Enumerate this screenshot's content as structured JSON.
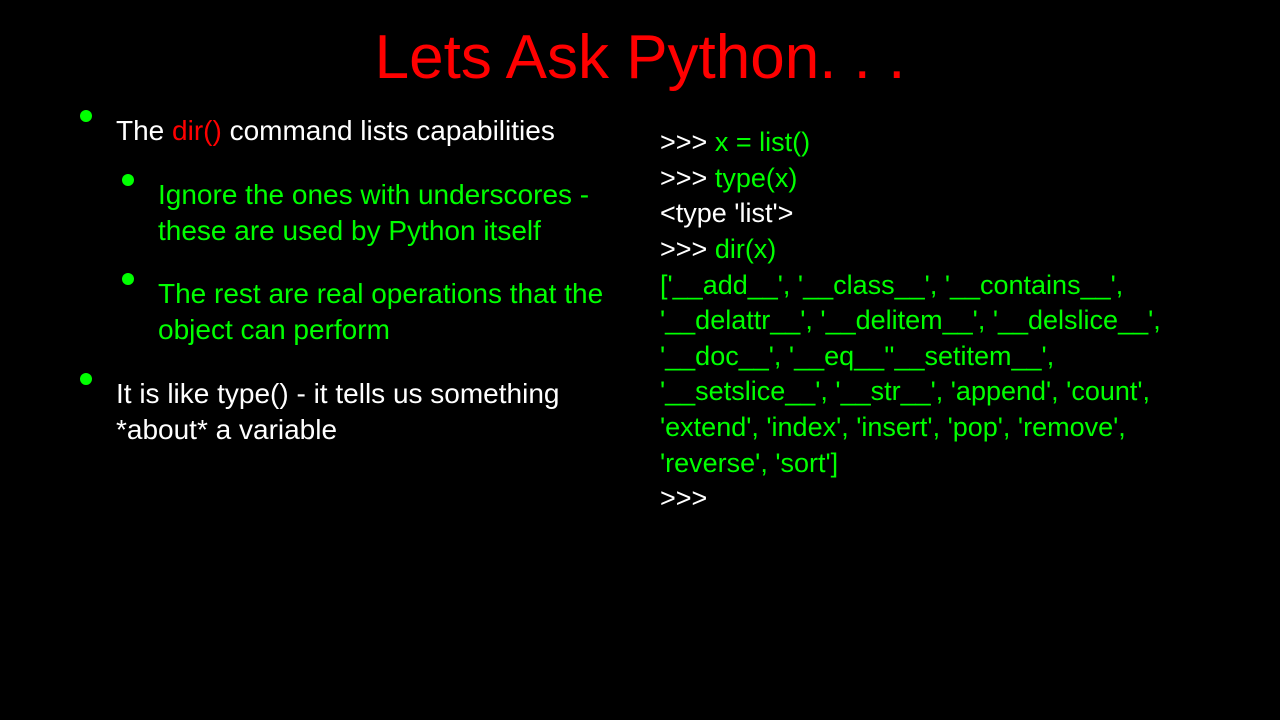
{
  "title": "Lets Ask Python. . .",
  "bullets": {
    "b1_pre": "The ",
    "b1_dir": "dir()",
    "b1_post": " command lists capabilities",
    "b2": "Ignore the ones with underscores - these are used by Python itself",
    "b3": "The rest are real operations that the object can perform",
    "b4": "It is like type() - it tells us something *about* a variable"
  },
  "code": {
    "l1a": ">>> ",
    "l1b": "x = list()",
    "l2a": ">>> ",
    "l2b": "type(x)",
    "l3": "<type 'list'>",
    "l4a": ">>> ",
    "l4b": "dir(x)",
    "l5": "['__add__', '__class__', '__contains__', '__delattr__', '__delitem__', '__delslice__', '__doc__', '__eq__''__setitem__', '__setslice__', '__str__', 'append', 'count', 'extend', 'index', 'insert', 'pop', 'remove', 'reverse', 'sort']",
    "l6": ">>>"
  }
}
